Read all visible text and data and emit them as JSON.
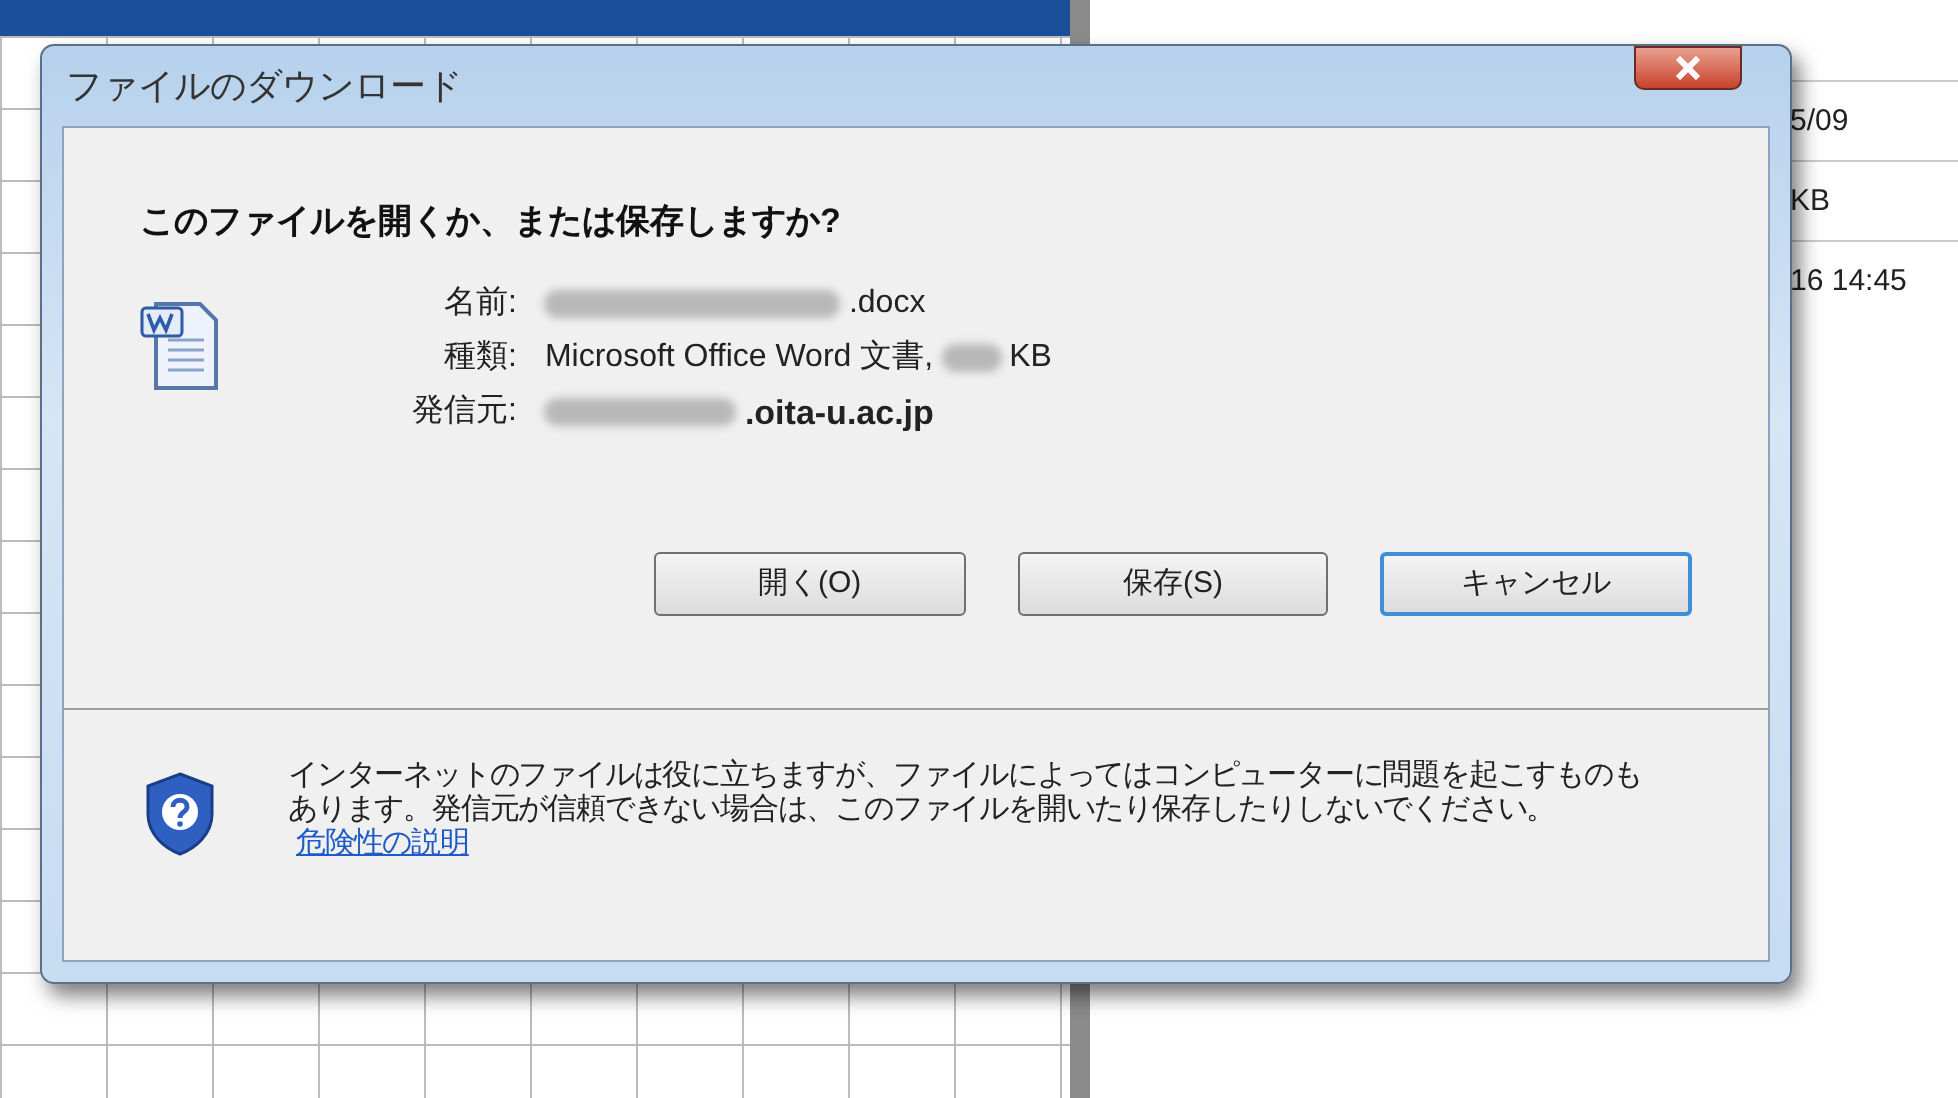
{
  "background": {
    "cells": [
      "5/09",
      "KB",
      "16 14:45"
    ]
  },
  "dialog": {
    "title": "ファイルのダウンロード",
    "question": "このファイルを開くか、または保存しますか?",
    "fields": [
      {
        "label": "名前:",
        "value": ".docx",
        "redacted": true,
        "bold": false
      },
      {
        "label": "種類:",
        "value": "Microsoft Office Word 文書,",
        "redacted": true,
        "bold": false,
        "value_suffix": "KB"
      },
      {
        "label": "発信元:",
        "value": ".oita-u.ac.jp",
        "redacted": true,
        "bold": true
      }
    ],
    "buttons": [
      {
        "label": "開く(O)",
        "default": false
      },
      {
        "label": "保存(S)",
        "default": false
      },
      {
        "label": "キャンセル",
        "default": true
      }
    ],
    "warning": "インターネットのファイルは役に立ちますが、ファイルによってはコンピューターに問題を起こすものもあります。発信元が信頼できない場合は、このファイルを開いたり保存したりしないでください。",
    "link": "危険性の説明"
  }
}
